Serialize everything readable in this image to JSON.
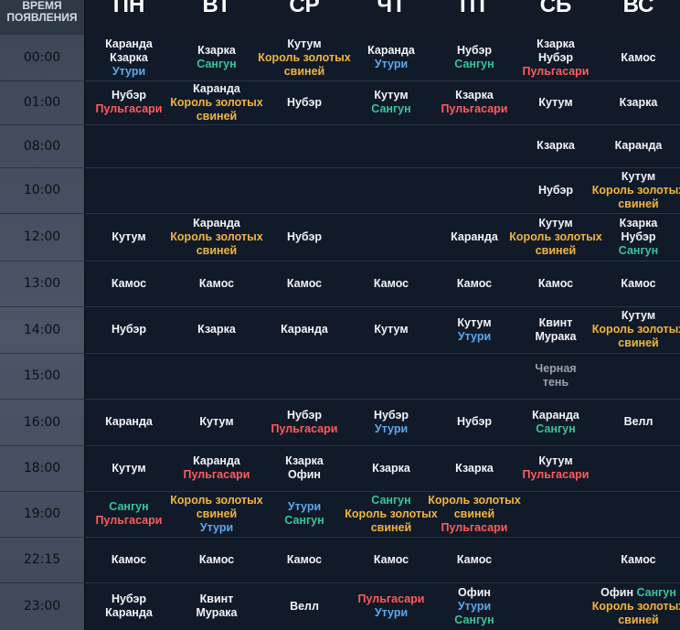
{
  "header": {
    "time_label_1": "ВРЕМЯ",
    "time_label_2": "ПОЯВЛЕНИЯ",
    "days": [
      "ПН",
      "ВТ",
      "СР",
      "ЧТ",
      "ПТ",
      "СБ",
      "ВС"
    ]
  },
  "colors": {
    "white": "#f2f4f7",
    "yellow": "#f2b43c",
    "blue": "#5aa9ee",
    "green": "#36c49a",
    "red": "#ff5c5c",
    "gray": "#9aa2ad"
  },
  "rows": [
    {
      "time": "00:00",
      "cells": [
        [
          [
            "Каранда",
            "w"
          ],
          [
            "Кзарка",
            "w"
          ],
          [
            "Утури",
            "b"
          ]
        ],
        [
          [
            "Кзарка",
            "w"
          ],
          [
            "Сангун",
            "g"
          ]
        ],
        [
          [
            "Кутум",
            "w"
          ],
          [
            "Король золотых",
            "y"
          ],
          [
            "свиней",
            "y"
          ]
        ],
        [
          [
            "Каранда",
            "w"
          ],
          [
            "Утури",
            "b"
          ]
        ],
        [
          [
            "Нубэр",
            "w"
          ],
          [
            "Сангун",
            "g"
          ]
        ],
        [
          [
            "Кзарка",
            "w"
          ],
          [
            "Нубэр",
            "w"
          ],
          [
            "Пульгасари",
            "r"
          ]
        ],
        [
          [
            "Камос",
            "w"
          ]
        ]
      ]
    },
    {
      "time": "01:00",
      "cells": [
        [
          [
            "Нубэр",
            "w"
          ],
          [
            "Пульгасари",
            "r"
          ]
        ],
        [
          [
            "Каранда",
            "w"
          ],
          [
            "Король золотых",
            "y"
          ],
          [
            "свиней",
            "y"
          ]
        ],
        [
          [
            "Нубэр",
            "w"
          ]
        ],
        [
          [
            "Кутум",
            "w"
          ],
          [
            "Сангун",
            "g"
          ]
        ],
        [
          [
            "Кзарка",
            "w"
          ],
          [
            "Пульгасари",
            "r"
          ]
        ],
        [
          [
            "Кутум",
            "w"
          ]
        ],
        [
          [
            "Кзарка",
            "w"
          ]
        ]
      ]
    },
    {
      "time": "08:00",
      "cells": [
        [],
        [],
        [],
        [],
        [],
        [
          [
            "Кзарка",
            "w"
          ]
        ],
        [
          [
            "Каранда",
            "w"
          ]
        ]
      ]
    },
    {
      "time": "10:00",
      "cells": [
        [],
        [],
        [],
        [],
        [],
        [
          [
            "Нубэр",
            "w"
          ]
        ],
        [
          [
            "Кутум",
            "w"
          ],
          [
            "Король золотых",
            "y"
          ],
          [
            "свиней",
            "y"
          ]
        ]
      ]
    },
    {
      "time": "12:00",
      "cells": [
        [
          [
            "Кутум",
            "w"
          ]
        ],
        [
          [
            "Каранда",
            "w"
          ],
          [
            "Король золотых",
            "y"
          ],
          [
            "свиней",
            "y"
          ]
        ],
        [
          [
            "Нубэр",
            "w"
          ]
        ],
        [],
        [
          [
            "Каранда",
            "w"
          ]
        ],
        [
          [
            "Кутум",
            "w"
          ],
          [
            "Король золотых",
            "y"
          ],
          [
            "свиней",
            "y"
          ]
        ],
        [
          [
            "Кзарка",
            "w"
          ],
          [
            "Нубэр",
            "w"
          ],
          [
            "Сангун",
            "g"
          ]
        ]
      ]
    },
    {
      "time": "13:00",
      "cells": [
        [
          [
            "Камос",
            "w"
          ]
        ],
        [
          [
            "Камос",
            "w"
          ]
        ],
        [
          [
            "Камос",
            "w"
          ]
        ],
        [
          [
            "Камос",
            "w"
          ]
        ],
        [
          [
            "Камос",
            "w"
          ]
        ],
        [
          [
            "Камос",
            "w"
          ]
        ],
        [
          [
            "Камос",
            "w"
          ]
        ]
      ]
    },
    {
      "time": "14:00",
      "cells": [
        [
          [
            "Нубэр",
            "w"
          ]
        ],
        [
          [
            "Кзарка",
            "w"
          ]
        ],
        [
          [
            "Каранда",
            "w"
          ]
        ],
        [
          [
            "Кутум",
            "w"
          ]
        ],
        [
          [
            "Кутум",
            "w"
          ],
          [
            "Утури",
            "b"
          ]
        ],
        [
          [
            "Квинт",
            "w"
          ],
          [
            "Мурака",
            "w"
          ]
        ],
        [
          [
            "Кутум",
            "w"
          ],
          [
            "Король золотых",
            "y"
          ],
          [
            "свиней",
            "y"
          ]
        ]
      ]
    },
    {
      "time": "15:00",
      "cells": [
        [],
        [],
        [],
        [],
        [],
        [
          [
            "Черная",
            "gray"
          ],
          [
            "тень",
            "gray"
          ]
        ],
        []
      ]
    },
    {
      "time": "16:00",
      "cells": [
        [
          [
            "Каранда",
            "w"
          ]
        ],
        [
          [
            "Кутум",
            "w"
          ]
        ],
        [
          [
            "Нубэр",
            "w"
          ],
          [
            "Пульгасари",
            "r"
          ]
        ],
        [
          [
            "Нубэр",
            "w"
          ],
          [
            "Утури",
            "b"
          ]
        ],
        [
          [
            "Нубэр",
            "w"
          ]
        ],
        [
          [
            "Каранда",
            "w"
          ],
          [
            "Сангун",
            "g"
          ]
        ],
        [
          [
            "Велл",
            "w"
          ]
        ]
      ]
    },
    {
      "time": "18:00",
      "cells": [
        [
          [
            "Кутум",
            "w"
          ]
        ],
        [
          [
            "Каранда",
            "w"
          ],
          [
            "Пульгасари",
            "r"
          ]
        ],
        [
          [
            "Кзарка",
            "w"
          ],
          [
            "Офин",
            "w"
          ]
        ],
        [
          [
            "Кзарка",
            "w"
          ]
        ],
        [
          [
            "Кзарка",
            "w"
          ]
        ],
        [
          [
            "Кутум",
            "w"
          ],
          [
            "Пульгасари",
            "r"
          ]
        ],
        []
      ]
    },
    {
      "time": "19:00",
      "cells": [
        [
          [
            "Сангун",
            "g"
          ],
          [
            "Пульгасари",
            "r"
          ]
        ],
        [
          [
            "Король золотых",
            "y"
          ],
          [
            "свиней",
            "y"
          ],
          [
            "Утури",
            "b"
          ]
        ],
        [
          [
            "Утури",
            "b"
          ],
          [
            "Сангун",
            "g"
          ]
        ],
        [
          [
            "Сангун",
            "g"
          ],
          [
            "Король золотых",
            "y"
          ],
          [
            "свиней",
            "y"
          ]
        ],
        [
          [
            "Король золотых",
            "y"
          ],
          [
            "свиней",
            "y"
          ],
          [
            "Пульгасари",
            "r"
          ]
        ],
        [],
        []
      ]
    },
    {
      "time": "22:15",
      "cells": [
        [
          [
            "Камос",
            "w"
          ]
        ],
        [
          [
            "Камос",
            "w"
          ]
        ],
        [
          [
            "Камос",
            "w"
          ]
        ],
        [
          [
            "Камос",
            "w"
          ]
        ],
        [
          [
            "Камос",
            "w"
          ]
        ],
        [],
        [
          [
            "Камос",
            "w"
          ]
        ]
      ]
    },
    {
      "time": "23:00",
      "cells": [
        [
          [
            "Нубэр",
            "w"
          ],
          [
            "Каранда",
            "w"
          ]
        ],
        [
          [
            "Квинт",
            "w"
          ],
          [
            "Мурака",
            "w"
          ]
        ],
        [
          [
            "Велл",
            "w"
          ]
        ],
        [
          [
            "Пульгасари",
            "r"
          ],
          [
            "Утури",
            "b"
          ]
        ],
        [
          [
            "Офин",
            "w"
          ],
          [
            "Утури",
            "b"
          ],
          [
            "Сангун",
            "g"
          ]
        ],
        [],
        [
          [
            "Офин Сангун",
            "wg"
          ],
          [
            "Король золотых",
            "y"
          ],
          [
            "свиней",
            "y"
          ]
        ]
      ]
    }
  ]
}
